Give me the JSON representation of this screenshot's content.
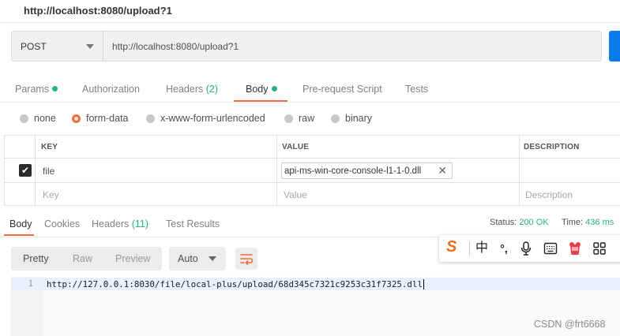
{
  "request": {
    "title": "http://localhost:8080/upload?1",
    "method": "POST",
    "url": "http://localhost:8080/upload?1"
  },
  "request_tabs": [
    {
      "label": "Params",
      "count": "",
      "dot": true
    },
    {
      "label": "Authorization",
      "count": "",
      "dot": false
    },
    {
      "label": "Headers",
      "count": "(2)",
      "dot": false
    },
    {
      "label": "Body",
      "count": "",
      "dot": true,
      "active": true
    },
    {
      "label": "Pre-request Script",
      "count": "",
      "dot": false
    },
    {
      "label": "Tests",
      "count": "",
      "dot": false
    }
  ],
  "body_types": [
    {
      "label": "none",
      "selected": false
    },
    {
      "label": "form-data",
      "selected": true
    },
    {
      "label": "x-www-form-urlencoded",
      "selected": false
    },
    {
      "label": "raw",
      "selected": false
    },
    {
      "label": "binary",
      "selected": false
    }
  ],
  "form_table": {
    "headers": [
      "KEY",
      "VALUE",
      "DESCRIPTION"
    ],
    "rows": [
      {
        "checked": true,
        "key": "file",
        "value": "api-ms-win-core-console-l1-1-0.dll"
      }
    ],
    "placeholders": {
      "key": "Key",
      "value": "Value",
      "description": "Description"
    }
  },
  "response_tabs": [
    {
      "label": "Body",
      "count": "",
      "active": true
    },
    {
      "label": "Cookies",
      "count": ""
    },
    {
      "label": "Headers",
      "count": "(11)"
    },
    {
      "label": "Test Results",
      "count": ""
    }
  ],
  "response_status": {
    "status_label": "Status:",
    "status_value": "200 OK",
    "time_label": "Time:",
    "time_value": "436 ms"
  },
  "response_toolbar": {
    "formats": [
      "Pretty",
      "Raw",
      "Preview"
    ],
    "active_format": "Pretty",
    "language": "Auto"
  },
  "response_body": {
    "line_number": "1",
    "text": "http://127.0.0.1:8030/file/local-plus/upload/68d345c7321c9253c31f7325.dll"
  },
  "ime_toolbar": {
    "logo": "S",
    "items": [
      "中",
      "°,",
      "mic-icon",
      "keyboard-icon",
      "skin-icon",
      "grid-icon"
    ]
  },
  "watermark": "CSDN @frt6668",
  "colors": {
    "accent": "#f26b3a",
    "green": "#26b47f",
    "send": "#097bed"
  }
}
